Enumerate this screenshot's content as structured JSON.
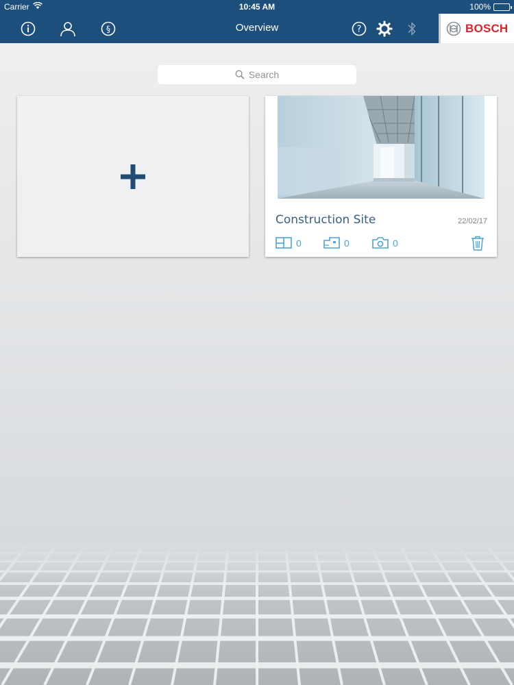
{
  "status_bar": {
    "carrier": "Carrier",
    "time": "10:45 AM",
    "battery": "100%"
  },
  "nav": {
    "title": "Overview",
    "left_icons": [
      "info-icon",
      "user-icon",
      "paragraph-icon"
    ],
    "right_icons": [
      "help-icon",
      "gear-icon",
      "bluetooth-icon"
    ],
    "brand": "BOSCH"
  },
  "search": {
    "placeholder": "Search"
  },
  "cards": {
    "new_project_symbol": "+",
    "project": {
      "title": "Construction Site",
      "date": "22/02/17",
      "stats": [
        {
          "icon": "floorplan-icon",
          "count": "0"
        },
        {
          "icon": "room-plan-icon",
          "count": "0"
        },
        {
          "icon": "camera-icon",
          "count": "0"
        }
      ],
      "delete_icon": "trash-icon"
    }
  },
  "colors": {
    "nav_bg": "#1d4f7c",
    "accent": "#4aa3d4",
    "brand_red": "#d8262f",
    "title_blue": "#3a5f85"
  }
}
